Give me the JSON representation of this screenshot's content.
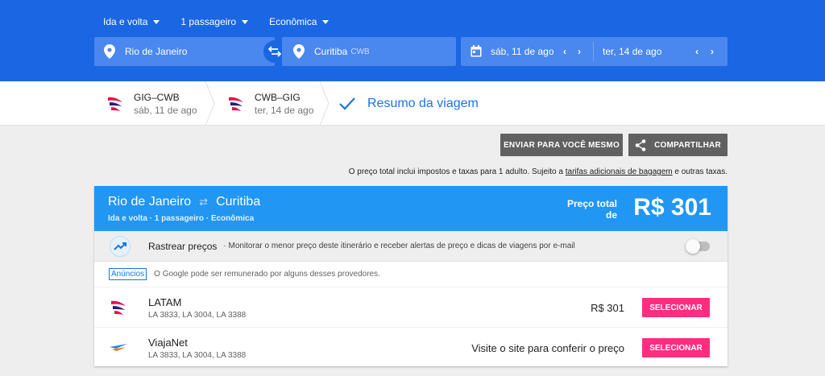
{
  "search": {
    "trip_type": "Ida e volta",
    "passengers": "1 passageiro",
    "cabin": "Econômica",
    "origin": "Rio de Janeiro",
    "destination": "Curitiba",
    "destination_code": "CWB",
    "depart_date": "sáb, 11 de ago",
    "return_date": "ter, 14 de ago"
  },
  "breadcrumbs": [
    {
      "route": "GIG–CWB",
      "date": "sáb, 11 de ago"
    },
    {
      "route": "CWB–GIG",
      "date": "ter, 14 de ago"
    }
  ],
  "summary_label": "Resumo da viagem",
  "actions": {
    "send_label": "ENVIAR PARA VOCÊ MESMO",
    "share_label": "COMPARTILHAR"
  },
  "note": {
    "before": "O preço total inclui impostos e taxas para 1 adulto. Sujeito a ",
    "link": "tarifas adicionais de bagagem",
    "after": " e outras taxas."
  },
  "card": {
    "origin": "Rio de Janeiro",
    "destination": "Curitiba",
    "subtitle": "Ida e volta · 1 passageiro · Econômica",
    "price_label_1": "Preço total",
    "price_label_2": "de",
    "price": "R$ 301"
  },
  "track": {
    "label": "Rastrear preços",
    "description": "·  Monitorar o menor preço deste itinerário e receber alertas de preço e dicas de viagens por e-mail",
    "enabled": false
  },
  "ads": {
    "badge": "Anúncios",
    "text": "O Google pode ser remunerado por alguns desses provedores."
  },
  "providers": [
    {
      "name": "LATAM",
      "flights": "LA 3833, LA 3004, LA 3388",
      "price": "R$ 301",
      "select_label": "SELECIONAR"
    },
    {
      "name": "ViajaNet",
      "flights": "LA 3833, LA 3004, LA 3388",
      "price": "Visite o site para conferir o preço",
      "select_label": "SELECIONAR"
    }
  ],
  "colors": {
    "header_blue": "#1a66e3",
    "card_blue": "#2196f3",
    "select_pink": "#ff2d7f",
    "link_blue": "#1a73e8"
  }
}
